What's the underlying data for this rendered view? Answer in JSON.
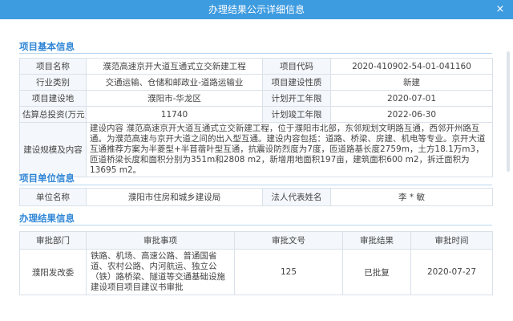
{
  "window": {
    "title": "办理结果公示详细信息",
    "close_label": "×"
  },
  "basic": {
    "section_title": "项目基本信息",
    "labels": {
      "name": "项目名称",
      "code": "项目代码",
      "industry": "行业类别",
      "nature": "项目建设性质",
      "location": "项目建设地",
      "start": "计划开工年限",
      "investment": "估算总投资(万元)",
      "end": "计划竣工年限",
      "scale": "建设规模及内容"
    },
    "values": {
      "name": "濮范高速京开大道互通式立交新建工程",
      "code": "2020-410902-54-01-041160",
      "industry": "交通运输、仓储和邮政业-道路运输业",
      "nature": "新建",
      "location": "濮阳市-华龙区",
      "start": "2020-07-01",
      "investment": "11740",
      "end": "2022-06-30",
      "scale": "建设内容 濮范高速京开大道互通式立交新建工程，位于濮阳市北部，东邻规划文明路互通，西邻开州路互通。为濮范高速与京开大道之间的出入型互通。建设内容包括：道路、桥梁、房建、机电等专业。京开大道互通推荐方案为半菱型+半苜蓿叶型互通，抗震设防烈度为7度，匝道路基长度2759m，土方18.1万m3，匝道桥梁长度和面积分别为351m和2808 m2，新增用地面积197亩，建筑面积600 m2，拆迁面积为13695 m2。"
    }
  },
  "unit": {
    "section_title": "项目单位信息",
    "labels": {
      "unit_name": "单位名称",
      "legal_rep": "法人代表姓名"
    },
    "values": {
      "unit_name": "濮阳市住房和城乡建设局",
      "legal_rep": "李 * 敏"
    }
  },
  "result": {
    "section_title": "办理结果信息",
    "headers": [
      "审批部门",
      "审批事项",
      "审批文号",
      "审批结果",
      "审批时间"
    ],
    "rows": [
      {
        "dept": "濮阳发改委",
        "matter": "铁路、机场、高速公路、普通国省道、农村公路、内河航运、独立公（铁）路桥梁、隧道等交通基础设施建设项目项目建议书审批",
        "doc_no": "125",
        "outcome": "已批复",
        "date": "2020-07-27"
      }
    ]
  }
}
